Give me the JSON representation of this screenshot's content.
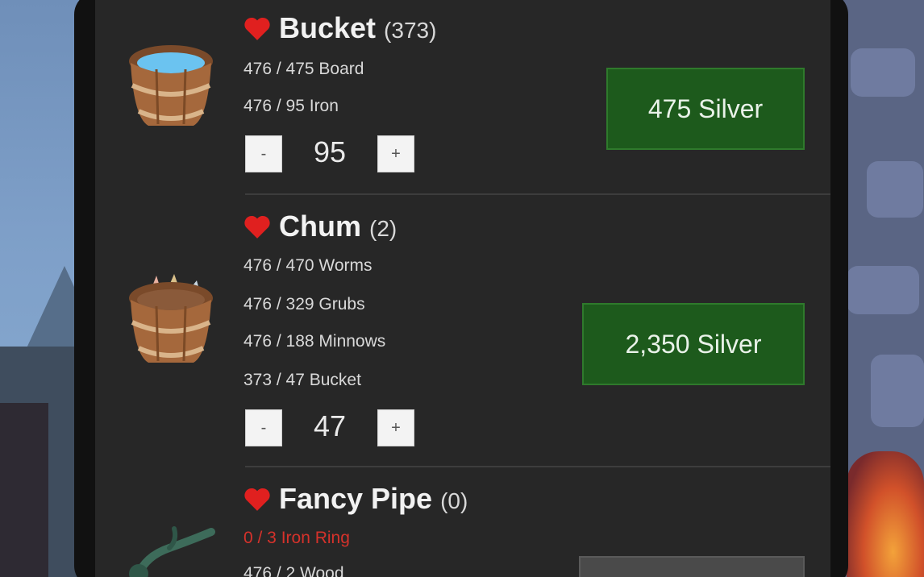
{
  "items": [
    {
      "name": "Bucket",
      "count": "(373)",
      "requirements": [
        {
          "text": "476 / 475 Board",
          "short": false
        },
        {
          "text": "476 / 95 Iron",
          "short": false
        }
      ],
      "quantity": "95",
      "minus_label": "-",
      "plus_label": "+",
      "price_label": "475 Silver"
    },
    {
      "name": "Chum",
      "count": "(2)",
      "requirements": [
        {
          "text": "476 / 470 Worms",
          "short": false
        },
        {
          "text": "476 / 329 Grubs",
          "short": false
        },
        {
          "text": "476 / 188 Minnows",
          "short": false
        },
        {
          "text": "373 / 47 Bucket",
          "short": false
        }
      ],
      "quantity": "47",
      "minus_label": "-",
      "plus_label": "+",
      "price_label": "2,350 Silver"
    },
    {
      "name": "Fancy Pipe",
      "count": "(0)",
      "requirements": [
        {
          "text": "0 / 3 Iron Ring",
          "short": true
        },
        {
          "text": "476 / 2 Wood",
          "short": false
        }
      ],
      "price_label": ""
    }
  ],
  "colors": {
    "heart": "#e0201f",
    "buy_button": "#1d5a1c",
    "shortage_text": "#d6322b"
  }
}
